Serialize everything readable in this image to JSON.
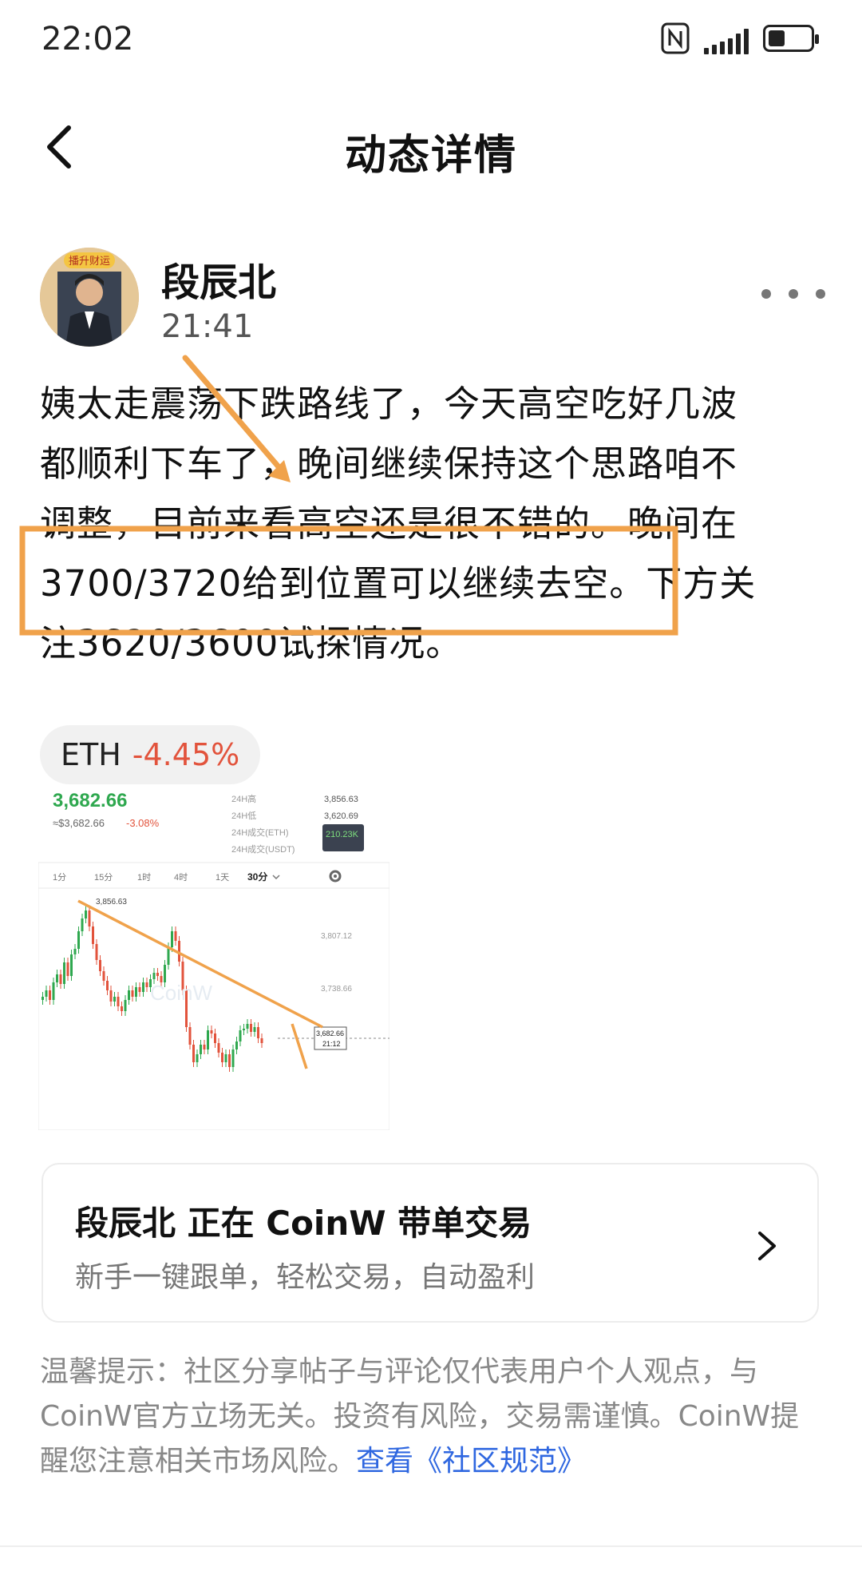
{
  "status_bar": {
    "time": "22:02"
  },
  "header": {
    "title": "动态详情"
  },
  "post": {
    "author": "段辰北",
    "time": "21:41",
    "avatar_badge": "播升财运",
    "lines": [
      "姨太走震荡下跌路线了，今天高空吃好几波",
      "都顺利下车了，晚间继续保持这个思路咱不",
      "调整，目前来看高空还是很不错的。晚间在",
      "3700/3720给到位置可以继续去空。下方关",
      "注3620/3600试探情况。"
    ]
  },
  "coin_tag": {
    "symbol": "ETH",
    "change": "-4.45%"
  },
  "chart_image": {
    "price": "3,682.66",
    "sub_price": "≈$3,682.66",
    "sub_change": "-3.08%",
    "stats": [
      {
        "label": "24H高",
        "value": "3,856.63"
      },
      {
        "label": "24H低",
        "value": "3,620.69"
      },
      {
        "label": "24H成交(ETH)",
        "value": "210.23K"
      },
      {
        "label": "24H成交(USDT)",
        "value": ""
      }
    ],
    "intervals": [
      "1分",
      "15分",
      "1时",
      "4时",
      "1天",
      "30分"
    ],
    "active_interval": "30分",
    "high_label": "3,856.63",
    "y_ticks": [
      "3,807.12",
      "3,738.66"
    ],
    "last_price": "3,682.66",
    "last_time": "21:12",
    "watermark": "CoinW"
  },
  "promo": {
    "title": "段辰北 正在 CoinW 带单交易",
    "subtitle": "新手一键跟单，轻松交易，自动盈利"
  },
  "disclaimer": {
    "text": "温馨提示：社区分享帖子与评论仅代表用户个人观点，与CoinW官方立场无关。投资有风险，交易需谨慎。CoinW提醒您注意相关市场风险。",
    "link": "查看《社区规范》"
  },
  "colors": {
    "accent_orange": "#f0a24b",
    "down_red": "#e2533c",
    "up_green": "#2fa84f",
    "link_blue": "#2f67e0"
  },
  "icons": [
    "nfc-icon",
    "signal-icon",
    "battery-icon",
    "back-arrow-icon",
    "more-dots-icon",
    "chevron-right-icon",
    "gear-icon"
  ]
}
